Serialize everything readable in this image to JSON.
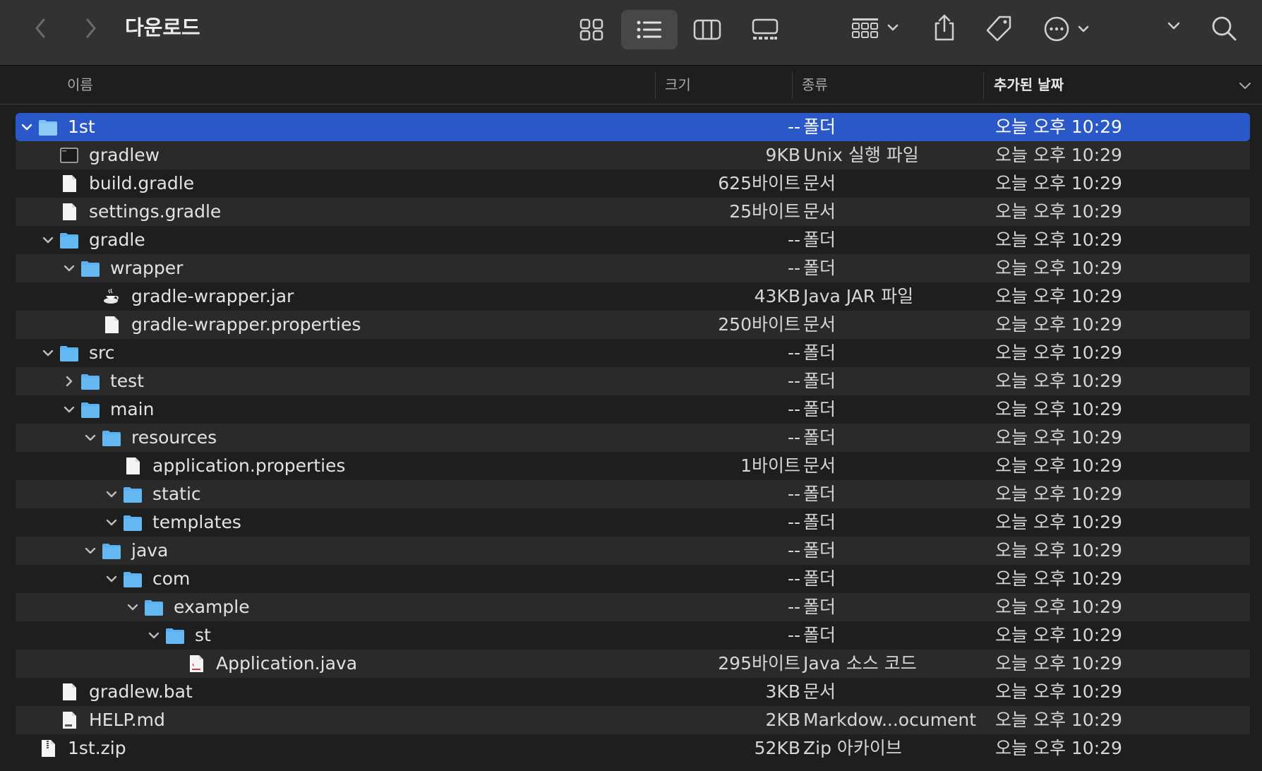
{
  "window": {
    "title": "다운로드"
  },
  "toolbar": {
    "back": "chevron-left-icon",
    "forward": "chevron-right-icon",
    "views": [
      "icon-view-icon",
      "list-view-icon",
      "column-view-icon",
      "gallery-view-icon"
    ],
    "active_view": "list",
    "group": "group-icon",
    "share": "share-icon",
    "tag": "tag-icon",
    "more": "ellipsis-circle-icon",
    "search": "search-icon"
  },
  "columns": {
    "name": "이름",
    "size": "크기",
    "kind": "종류",
    "date_added": "추가된 날짜"
  },
  "colors": {
    "selection": "#2b58c8",
    "folder": "#5ab0f0",
    "background": "#1e1e1e"
  },
  "rows": [
    {
      "name": "1st",
      "size": "--",
      "kind": "폴더",
      "date": "오늘 오후 10:29",
      "depth": 0,
      "icon": "folder",
      "chev": "down",
      "selected": true
    },
    {
      "name": "gradlew",
      "size": "9KB",
      "kind": "Unix 실행 파일",
      "date": "오늘 오후 10:29",
      "depth": 1,
      "icon": "exec"
    },
    {
      "name": "build.gradle",
      "size": "625바이트",
      "kind": "문서",
      "date": "오늘 오후 10:29",
      "depth": 1,
      "icon": "doc"
    },
    {
      "name": "settings.gradle",
      "size": "25바이트",
      "kind": "문서",
      "date": "오늘 오후 10:29",
      "depth": 1,
      "icon": "doc"
    },
    {
      "name": "gradle",
      "size": "--",
      "kind": "폴더",
      "date": "오늘 오후 10:29",
      "depth": 1,
      "icon": "folder",
      "chev": "down"
    },
    {
      "name": "wrapper",
      "size": "--",
      "kind": "폴더",
      "date": "오늘 오후 10:29",
      "depth": 2,
      "icon": "folder",
      "chev": "down"
    },
    {
      "name": "gradle-wrapper.jar",
      "size": "43KB",
      "kind": "Java JAR 파일",
      "date": "오늘 오후 10:29",
      "depth": 3,
      "icon": "jar"
    },
    {
      "name": "gradle-wrapper.properties",
      "size": "250바이트",
      "kind": "문서",
      "date": "오늘 오후 10:29",
      "depth": 3,
      "icon": "doc"
    },
    {
      "name": "src",
      "size": "--",
      "kind": "폴더",
      "date": "오늘 오후 10:29",
      "depth": 1,
      "icon": "folder",
      "chev": "down"
    },
    {
      "name": "test",
      "size": "--",
      "kind": "폴더",
      "date": "오늘 오후 10:29",
      "depth": 2,
      "icon": "folder",
      "chev": "right"
    },
    {
      "name": "main",
      "size": "--",
      "kind": "폴더",
      "date": "오늘 오후 10:29",
      "depth": 2,
      "icon": "folder",
      "chev": "down"
    },
    {
      "name": "resources",
      "size": "--",
      "kind": "폴더",
      "date": "오늘 오후 10:29",
      "depth": 3,
      "icon": "folder",
      "chev": "down"
    },
    {
      "name": "application.properties",
      "size": "1바이트",
      "kind": "문서",
      "date": "오늘 오후 10:29",
      "depth": 4,
      "icon": "doc"
    },
    {
      "name": "static",
      "size": "--",
      "kind": "폴더",
      "date": "오늘 오후 10:29",
      "depth": 4,
      "icon": "folder",
      "chev": "down"
    },
    {
      "name": "templates",
      "size": "--",
      "kind": "폴더",
      "date": "오늘 오후 10:29",
      "depth": 4,
      "icon": "folder",
      "chev": "down"
    },
    {
      "name": "java",
      "size": "--",
      "kind": "폴더",
      "date": "오늘 오후 10:29",
      "depth": 3,
      "icon": "folder",
      "chev": "down"
    },
    {
      "name": "com",
      "size": "--",
      "kind": "폴더",
      "date": "오늘 오후 10:29",
      "depth": 4,
      "icon": "folder",
      "chev": "down"
    },
    {
      "name": "example",
      "size": "--",
      "kind": "폴더",
      "date": "오늘 오후 10:29",
      "depth": 5,
      "icon": "folder",
      "chev": "down"
    },
    {
      "name": "st",
      "size": "--",
      "kind": "폴더",
      "date": "오늘 오후 10:29",
      "depth": 6,
      "icon": "folder",
      "chev": "down"
    },
    {
      "name": "Application.java",
      "size": "295바이트",
      "kind": "Java 소스 코드",
      "date": "오늘 오후 10:29",
      "depth": 7,
      "icon": "java"
    },
    {
      "name": "gradlew.bat",
      "size": "3KB",
      "kind": "문서",
      "date": "오늘 오후 10:29",
      "depth": 1,
      "icon": "doc"
    },
    {
      "name": "HELP.md",
      "size": "2KB",
      "kind": "Markdow...ocument",
      "date": "오늘 오후 10:29",
      "depth": 1,
      "icon": "md"
    },
    {
      "name": "1st.zip",
      "size": "52KB",
      "kind": "Zip 아카이브",
      "date": "오늘 오후 10:29",
      "depth": 0,
      "icon": "zip"
    }
  ]
}
